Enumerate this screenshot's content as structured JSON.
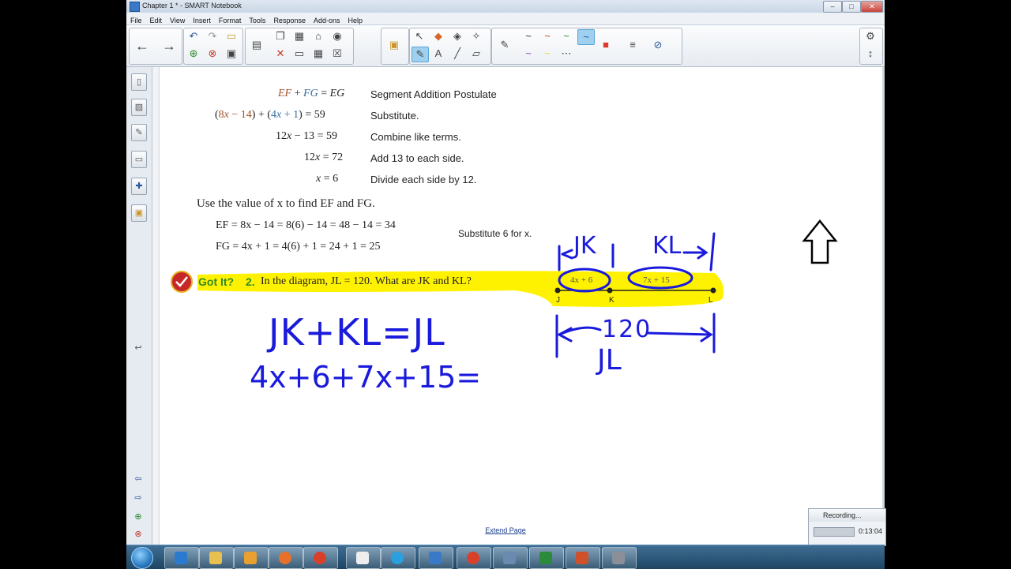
{
  "window": {
    "title": "Chapter 1 * - SMART Notebook",
    "controls": [
      "–",
      "□",
      "✕"
    ]
  },
  "menu": [
    "File",
    "Edit",
    "View",
    "Insert",
    "Format",
    "Tools",
    "Response",
    "Add-ons",
    "Help"
  ],
  "toolbar": {
    "groups": [
      {
        "icons": [
          "back-arrow",
          "forward-arrow"
        ]
      },
      {
        "icons": [
          "undo",
          "redo",
          "open",
          "add-page",
          "delete-page",
          "save"
        ]
      },
      {
        "icons": [
          "screen-shade",
          "paste",
          "screen-capture",
          "document-camera",
          "table",
          "delete"
        ]
      },
      {
        "icons": [
          "activity-builder"
        ]
      },
      {
        "icons": [
          "select",
          "fill",
          "eraser",
          "magic-pen",
          "pens",
          "text",
          "line",
          "shapes"
        ]
      },
      {
        "icons": [
          "pen-black",
          "pen-red",
          "pen-green",
          "pen-blue",
          "pen-purple",
          "pen-yellow",
          "pen-dashed",
          "color-grid",
          "line-props",
          "link"
        ]
      },
      {
        "icons": [
          "gear",
          "move-toolbar"
        ]
      }
    ]
  },
  "sidebar": [
    "page-sorter",
    "gallery",
    "attachments",
    "properties",
    "add-ons",
    "lock"
  ],
  "textbook": {
    "steps": [
      {
        "eq_html": "<span style=\"color:#a0522d\"><i>EF</i></span> + <span style=\"color:#3a6ea5\"><i>FG</i></span> = <i>EG</i>",
        "reason": "Segment Addition Postulate"
      },
      {
        "eq_html": "(<span style=\"color:#a0522d\">8<i>x</i> − 14</span>) + (<span style=\"color:#3a6ea5\">4<i>x</i> + 1</span>) = 59",
        "reason": "Substitute."
      },
      {
        "eq_html": "12<i>x</i> − 13 = 59",
        "reason": "Combine like terms."
      },
      {
        "eq_html": "12<i>x</i> = 72",
        "reason": "Add 13 to each side."
      },
      {
        "eq_html": "<i>x</i> = 6",
        "reason": "Divide each side by 12."
      }
    ],
    "use_value": "Use the value of x to find EF and FG.",
    "ef_line": "EF = 8x − 14 = 8(6) − 14 = 48 − 14 = 34",
    "fg_line": "FG = 4x + 1 = 4(6) + 1 = 24 + 1 = 25",
    "substitute_note": "Substitute 6 for x.",
    "got_it_label": "Got It?",
    "got_it_number": "2.",
    "got_it_question": "In the diagram, JL = 120. What are JK and KL?",
    "diagram": {
      "seg1": "4x + 6",
      "seg2": "7x + 15",
      "points": [
        "J",
        "K",
        "L"
      ]
    }
  },
  "handwriting": {
    "line1": "JK+KL=JL",
    "line2": "4x+6+7x+15=",
    "top_jk": "JK",
    "top_kl": "KL",
    "total": "120",
    "total_label": "JL"
  },
  "footer": {
    "extend_page": "Extend Page"
  },
  "recording": {
    "title": "Recording...",
    "time": "0:13:04"
  },
  "taskbar": [
    "ie",
    "explorer",
    "media",
    "firefox",
    "chrome",
    "calculator",
    "skype",
    "notebook",
    "chrome-2",
    "remote",
    "excel",
    "powerpoint",
    "tool"
  ],
  "colors": {
    "highlight": "#fff200",
    "ink": "#1a1adc",
    "accent_green": "#2c8a2c"
  }
}
